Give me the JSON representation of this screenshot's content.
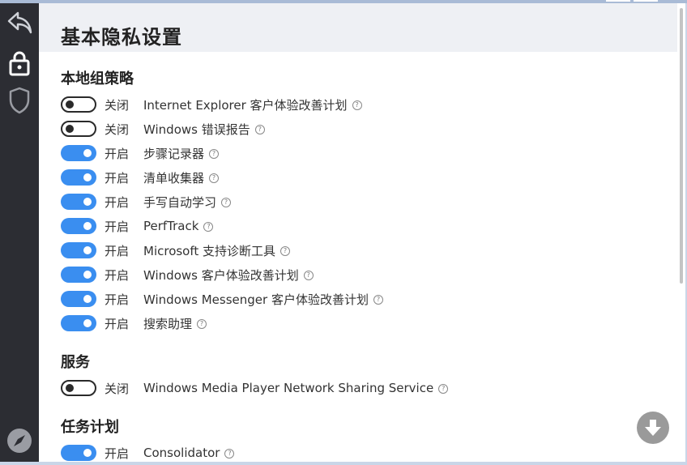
{
  "header": {
    "title": "基本隐私设置"
  },
  "colors": {
    "accent": "#3a8ef0",
    "sidebar": "#2c2d33",
    "header_bg": "#eef0f4"
  },
  "sidebar": {
    "items": [
      {
        "icon": "back-arrow-icon"
      },
      {
        "icon": "lock-icon"
      },
      {
        "icon": "shield-icon"
      },
      {
        "icon": "compass-icon"
      }
    ]
  },
  "sections": [
    {
      "title": "本地组策略",
      "items": [
        {
          "state": "关闭",
          "on": false,
          "label": "Internet Explorer 客户体验改善计划"
        },
        {
          "state": "关闭",
          "on": false,
          "label": "Windows 错误报告"
        },
        {
          "state": "开启",
          "on": true,
          "label": "步骤记录器"
        },
        {
          "state": "开启",
          "on": true,
          "label": "清单收集器"
        },
        {
          "state": "开启",
          "on": true,
          "label": "手写自动学习"
        },
        {
          "state": "开启",
          "on": true,
          "label": "PerfTrack"
        },
        {
          "state": "开启",
          "on": true,
          "label": "Microsoft 支持诊断工具"
        },
        {
          "state": "开启",
          "on": true,
          "label": "Windows 客户体验改善计划"
        },
        {
          "state": "开启",
          "on": true,
          "label": "Windows Messenger 客户体验改善计划"
        },
        {
          "state": "开启",
          "on": true,
          "label": "搜索助理"
        }
      ]
    },
    {
      "title": "服务",
      "items": [
        {
          "state": "关闭",
          "on": false,
          "label": "Windows Media Player Network Sharing Service"
        }
      ]
    },
    {
      "title": "任务计划",
      "items": [
        {
          "state": "开启",
          "on": true,
          "label": "Consolidator"
        }
      ]
    }
  ],
  "help_glyph": "?",
  "fab": {
    "icon": "download-arrow-icon"
  }
}
